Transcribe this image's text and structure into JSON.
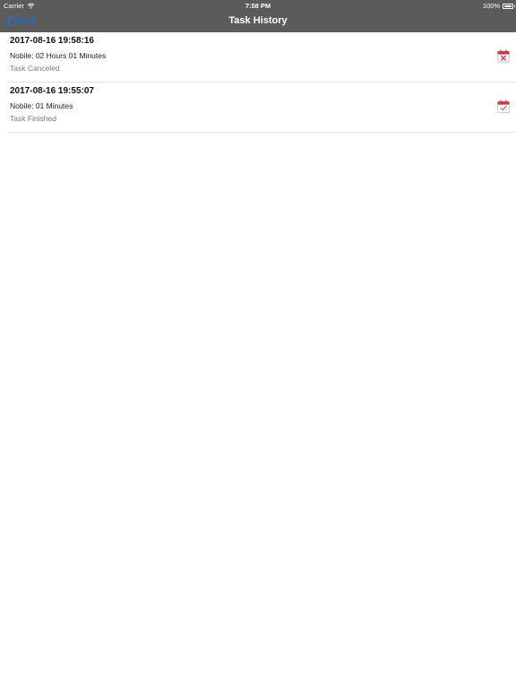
{
  "status_bar": {
    "carrier": "Carrier",
    "time": "7:58 PM",
    "battery": "100%"
  },
  "nav": {
    "back_label": "Back",
    "title": "Task History"
  },
  "tasks": [
    {
      "datetime": "2017-08-16 19:58:16",
      "duration": "Nobile: 02 Hours 01 Minutes",
      "status": "Task Canceled",
      "icon": "calendar-cancel-icon"
    },
    {
      "datetime": "2017-08-16 19:55:07",
      "duration": "Nobile: 01 Minutes",
      "status": "Task Finished",
      "icon": "calendar-check-icon"
    }
  ],
  "colors": {
    "header_bg": "#5b5b5b",
    "accent": "#1a6fe8",
    "cancel": "#d0364b",
    "finished": "#8c8c8c"
  }
}
